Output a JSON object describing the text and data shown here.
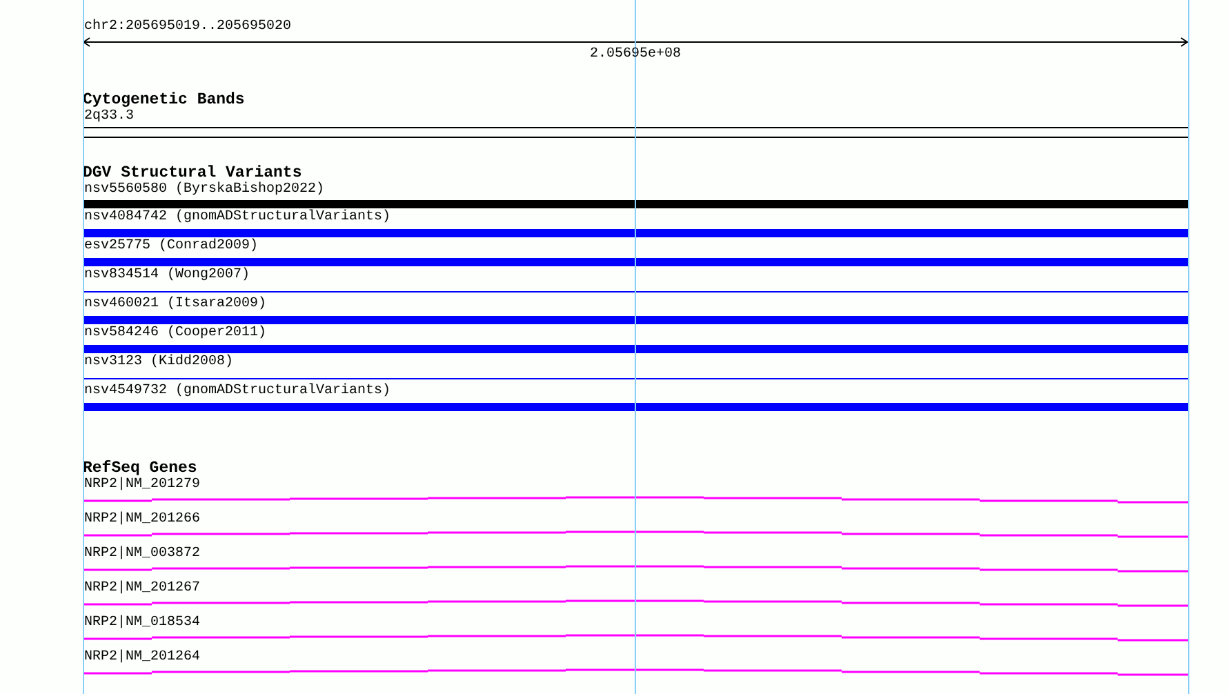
{
  "location": "chr2:205695019..205695020",
  "ruler": {
    "label": "2.05695e+08"
  },
  "cytogenetic_bands": {
    "title": "Cytogenetic Bands",
    "bands": [
      {
        "label": "2q33.3"
      }
    ]
  },
  "dgv_structural_variants": {
    "title": "DGV Structural Variants",
    "variants": [
      {
        "label": "nsv5560580 (ByrskaBishop2022)",
        "kind": "thick",
        "color": "#000000"
      },
      {
        "label": "nsv4084742 (gnomADStructuralVariants)",
        "kind": "thick",
        "color": "#0000ff"
      },
      {
        "label": "esv25775 (Conrad2009)",
        "kind": "thick",
        "color": "#0000ff"
      },
      {
        "label": "nsv834514 (Wong2007)",
        "kind": "thin",
        "color": "#0000ff"
      },
      {
        "label": "nsv460021 (Itsara2009)",
        "kind": "thick",
        "color": "#0000ff"
      },
      {
        "label": "nsv584246 (Cooper2011)",
        "kind": "thick",
        "color": "#0000ff"
      },
      {
        "label": "nsv3123 (Kidd2008)",
        "kind": "thin",
        "color": "#0000ff"
      },
      {
        "label": "nsv4549732 (gnomADStructuralVariants)",
        "kind": "thick",
        "color": "#0000ff"
      }
    ]
  },
  "refseq_genes": {
    "title": "RefSeq Genes",
    "genes": [
      {
        "label": "NRP2|NM_201279"
      },
      {
        "label": "NRP2|NM_201266"
      },
      {
        "label": "NRP2|NM_003872"
      },
      {
        "label": "NRP2|NM_201267"
      },
      {
        "label": "NRP2|NM_018534"
      },
      {
        "label": "NRP2|NM_201264"
      }
    ]
  }
}
